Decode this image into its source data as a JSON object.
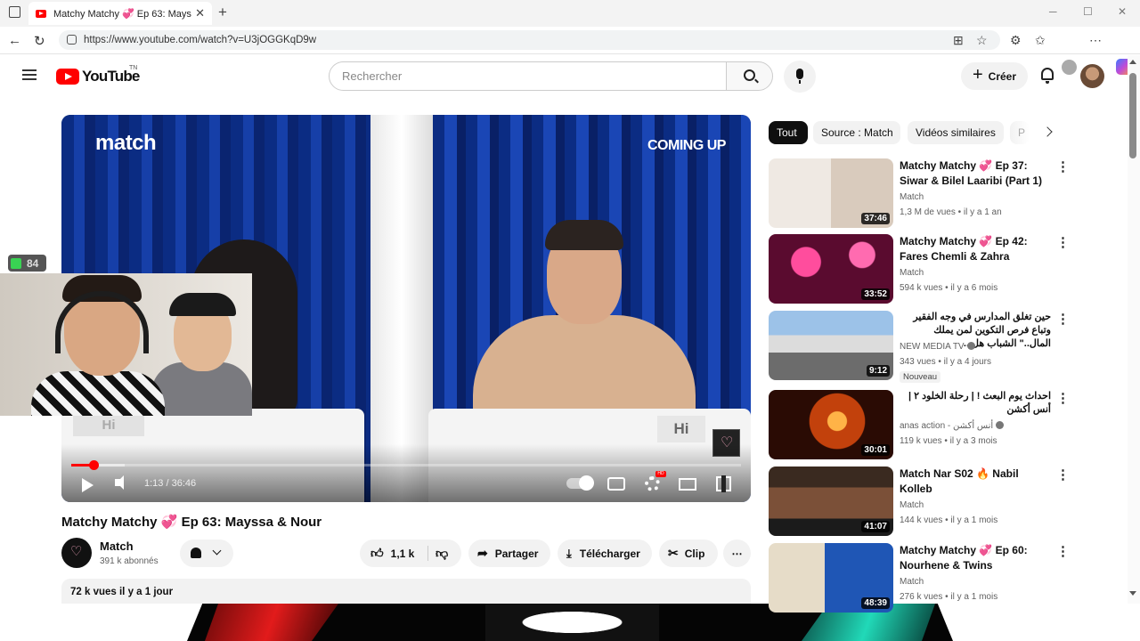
{
  "browser": {
    "tab_title": "Matchy Matchy 💞 Ep 63: Mayssa",
    "url": "https://www.youtube.com/watch?v=U3jOGGKqD9w",
    "new_tab": "+",
    "close": "✕",
    "minimize": "─",
    "maximize": "☐",
    "win_close": "✕"
  },
  "header": {
    "logo_text": "YouTube",
    "logo_suffix": "TN",
    "search_placeholder": "Rechercher",
    "create_label": "Créer",
    "create_plus": "+"
  },
  "player": {
    "brand": "match",
    "coming_up": "COMING UP",
    "sign_left": "Hi",
    "sign_right": "Hi",
    "time_display": "1:13 / 36:46",
    "progress_fraction": 0.033,
    "buffered_fraction": 0.08,
    "hd_badge": "HD"
  },
  "overlay": {
    "fps_value": "84"
  },
  "video": {
    "title_prefix": "Matchy Matchy",
    "title_heart": "💞",
    "title_suffix": "Ep 63: Mayssa & Nour",
    "channel_name": "Match",
    "subscribers": "391 k abonnés",
    "likes": "1,1 k",
    "share_label": "Partager",
    "download_label": "Télécharger",
    "clip_label": "Clip",
    "more_label": "⋯",
    "views_date": "72 k vues  il y a 1 jour"
  },
  "chips": [
    "Tout",
    "Source : Match",
    "Vidéos similaires",
    "P"
  ],
  "recommendations": [
    {
      "title": "Matchy Matchy 💞 Ep 37: Siwar & Bilel Laaribi (Part 1)",
      "channel": "Match",
      "meta": "1,3 M de vues • il y a 1 an",
      "duration": "37:46",
      "rtl": false,
      "verified": false,
      "badge": ""
    },
    {
      "title": "Matchy Matchy 💞 Ep 42: Fares Chemli & Zahra",
      "channel": "Match",
      "meta": "594 k vues • il y a 6 mois",
      "duration": "33:52",
      "rtl": false,
      "verified": false,
      "badge": ""
    },
    {
      "title": "حين تغلق المدارس في وجه الفقير وتباع فرص التكوين لمن يملك المال..\" الشباب هل...",
      "channel": "NEW MEDIA TV",
      "meta": "343 vues • il y a 4 jours",
      "duration": "9:12",
      "rtl": true,
      "verified": true,
      "badge": "Nouveau"
    },
    {
      "title": "احداث يوم البعث ! | رحلة الخلود ٢ | أنس أكشن",
      "channel": "anas action - أنس أكشن",
      "meta": "119 k vues • il y a 3 mois",
      "duration": "30:01",
      "rtl": true,
      "verified": true,
      "badge": ""
    },
    {
      "title": "Match Nar S02 🔥 Nabil Kolleb",
      "channel": "Match",
      "meta": "144 k vues • il y a 1 mois",
      "duration": "41:07",
      "rtl": false,
      "verified": false,
      "badge": ""
    },
    {
      "title": "Matchy Matchy 💞 Ep 60: Nourhene & Twins",
      "channel": "Match",
      "meta": "276 k vues • il y a 1 mois",
      "duration": "48:39",
      "rtl": false,
      "verified": false,
      "badge": ""
    }
  ],
  "colors": {
    "brand_red": "#ff0000",
    "chip_active": "#0f0f0f",
    "secondary_text": "#606060"
  }
}
